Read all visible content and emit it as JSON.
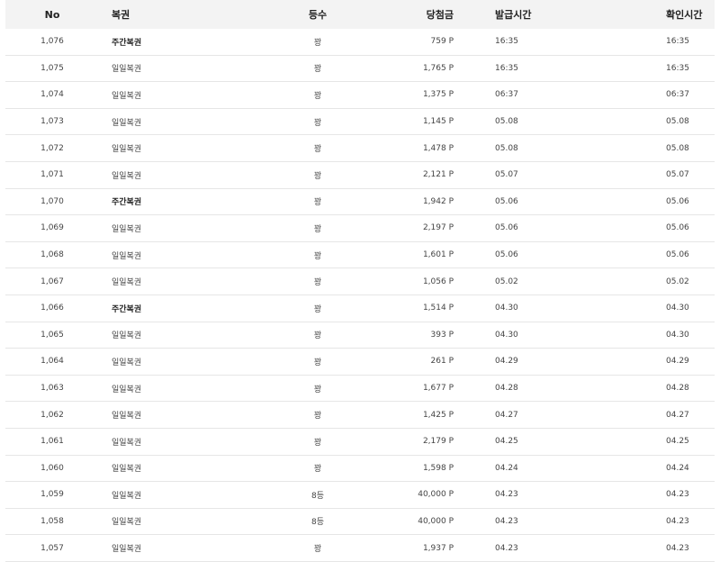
{
  "headers": {
    "no": "No",
    "lottery": "복권",
    "rank": "등수",
    "prize": "당첨금",
    "issued": "발급시간",
    "checked": "확인시간"
  },
  "rows": [
    {
      "no": "1,076",
      "lottery": "주간복권",
      "rank": "꽝",
      "prize": "759 P",
      "issued": "16:35",
      "checked": "16:35",
      "bold": true
    },
    {
      "no": "1,075",
      "lottery": "일일복권",
      "rank": "꽝",
      "prize": "1,765 P",
      "issued": "16:35",
      "checked": "16:35",
      "bold": false
    },
    {
      "no": "1,074",
      "lottery": "일일복권",
      "rank": "꽝",
      "prize": "1,375 P",
      "issued": "06:37",
      "checked": "06:37",
      "bold": false
    },
    {
      "no": "1,073",
      "lottery": "일일복권",
      "rank": "꽝",
      "prize": "1,145 P",
      "issued": "05.08",
      "checked": "05.08",
      "bold": false
    },
    {
      "no": "1,072",
      "lottery": "일일복권",
      "rank": "꽝",
      "prize": "1,478 P",
      "issued": "05.08",
      "checked": "05.08",
      "bold": false
    },
    {
      "no": "1,071",
      "lottery": "일일복권",
      "rank": "꽝",
      "prize": "2,121 P",
      "issued": "05.07",
      "checked": "05.07",
      "bold": false
    },
    {
      "no": "1,070",
      "lottery": "주간복권",
      "rank": "꽝",
      "prize": "1,942 P",
      "issued": "05.06",
      "checked": "05.06",
      "bold": true
    },
    {
      "no": "1,069",
      "lottery": "일일복권",
      "rank": "꽝",
      "prize": "2,197 P",
      "issued": "05.06",
      "checked": "05.06",
      "bold": false
    },
    {
      "no": "1,068",
      "lottery": "일일복권",
      "rank": "꽝",
      "prize": "1,601 P",
      "issued": "05.06",
      "checked": "05.06",
      "bold": false
    },
    {
      "no": "1,067",
      "lottery": "일일복권",
      "rank": "꽝",
      "prize": "1,056 P",
      "issued": "05.02",
      "checked": "05.02",
      "bold": false
    },
    {
      "no": "1,066",
      "lottery": "주간복권",
      "rank": "꽝",
      "prize": "1,514 P",
      "issued": "04.30",
      "checked": "04.30",
      "bold": true
    },
    {
      "no": "1,065",
      "lottery": "일일복권",
      "rank": "꽝",
      "prize": "393 P",
      "issued": "04.30",
      "checked": "04.30",
      "bold": false
    },
    {
      "no": "1,064",
      "lottery": "일일복권",
      "rank": "꽝",
      "prize": "261 P",
      "issued": "04.29",
      "checked": "04.29",
      "bold": false
    },
    {
      "no": "1,063",
      "lottery": "일일복권",
      "rank": "꽝",
      "prize": "1,677 P",
      "issued": "04.28",
      "checked": "04.28",
      "bold": false
    },
    {
      "no": "1,062",
      "lottery": "일일복권",
      "rank": "꽝",
      "prize": "1,425 P",
      "issued": "04.27",
      "checked": "04.27",
      "bold": false
    },
    {
      "no": "1,061",
      "lottery": "일일복권",
      "rank": "꽝",
      "prize": "2,179 P",
      "issued": "04.25",
      "checked": "04.25",
      "bold": false
    },
    {
      "no": "1,060",
      "lottery": "일일복권",
      "rank": "꽝",
      "prize": "1,598 P",
      "issued": "04.24",
      "checked": "04.24",
      "bold": false
    },
    {
      "no": "1,059",
      "lottery": "일일복권",
      "rank": "8등",
      "prize": "40,000 P",
      "issued": "04.23",
      "checked": "04.23",
      "bold": false
    },
    {
      "no": "1,058",
      "lottery": "일일복권",
      "rank": "8등",
      "prize": "40,000 P",
      "issued": "04.23",
      "checked": "04.23",
      "bold": false
    },
    {
      "no": "1,057",
      "lottery": "일일복권",
      "rank": "꽝",
      "prize": "1,937 P",
      "issued": "04.23",
      "checked": "04.23",
      "bold": false
    }
  ]
}
